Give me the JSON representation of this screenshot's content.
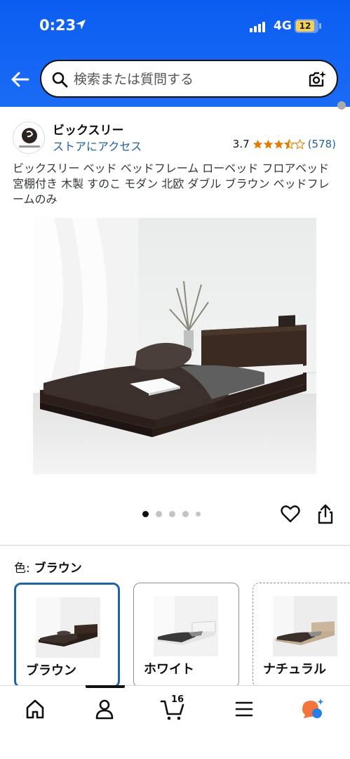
{
  "status_bar": {
    "time": "0:23",
    "network": "4G",
    "battery": "12"
  },
  "search": {
    "placeholder": "検索または質問する"
  },
  "product": {
    "brand_name": "ビックスリー",
    "store_link": "ストアにアクセス",
    "rating_value": "3.7",
    "rating_stars": 3.5,
    "rating_count": "(578)",
    "title": "ビックスリー ベッド ベッドフレーム ローベッド フロアベッド 宮棚付き 木製 すのこ モダン 北欧 ダブル ブラウン ベッドフレームのみ",
    "image_count": 5,
    "active_image": 1
  },
  "variants": {
    "label": "色:",
    "selected": "ブラウン",
    "options": [
      {
        "label": "ブラウン"
      },
      {
        "label": "ホワイト"
      },
      {
        "label": "ナチュラル"
      }
    ]
  },
  "bottom_nav": {
    "items": [
      "home-icon",
      "account-icon",
      "cart-icon",
      "menu-icon",
      "rufus-icon"
    ],
    "cart_count": "16"
  },
  "colors": {
    "header_blue": "#1566f5",
    "link_blue": "#2162a1",
    "star_orange": "#e57a00",
    "selected_border": "#2162a1",
    "rufus_orange": "#f3743a",
    "rufus_blue": "#2a7fe5"
  }
}
